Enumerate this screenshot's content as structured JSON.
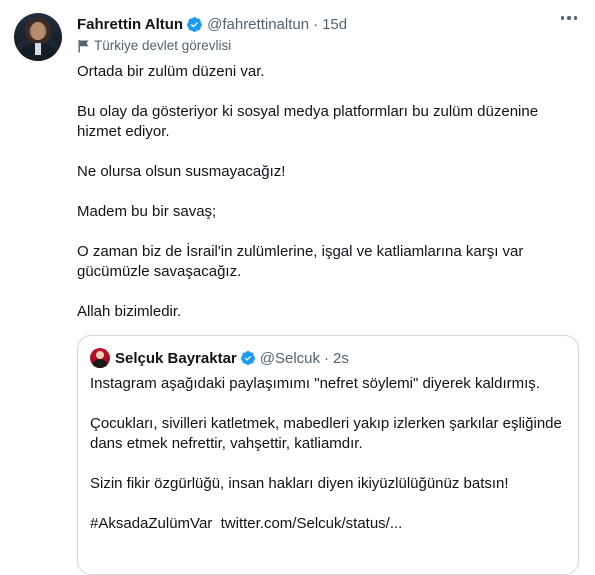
{
  "tweet": {
    "author_name": "Fahrettin Altun",
    "author_handle": "@fahrettinaltun",
    "separator": "·",
    "time": "15d",
    "label": "Türkiye devlet görevlisi",
    "paragraphs": [
      "Ortada bir zulüm düzeni var.",
      "Bu olay da gösteriyor ki sosyal medya platformları bu zulüm düzenine hizmet ediyor.",
      "Ne olursa olsun susmayacağız!",
      "Madem bu bir savaş;",
      "O zaman biz de İsrail'in zulümlerine, işgal ve katliamlarına karşı var gücümüzle savaşacağız.",
      "Allah bizimledir."
    ]
  },
  "quote": {
    "author_name": "Selçuk Bayraktar",
    "author_handle": "@Selcuk",
    "separator": "·",
    "time": "2s",
    "paragraphs": [
      "Instagram aşağıdaki paylaşımımı \"nefret söylemi\" diyerek kaldırmış.",
      "Çocukları, sivilleri katletmek, mabedleri yakıp izlerken şarkılar eşliğinde dans etmek nefrettir, vahşettir, katliamdır.",
      "Sizin fikir özgürlüğü, insan hakları diyen ikiyüzlülüğünüz batsın!"
    ],
    "hashtag": "#AksadaZulümVar",
    "link": "twitter.com/Selcuk/status/..."
  },
  "icons": {
    "verified": "verified-badge-icon",
    "label": "flag-icon",
    "more": "more-icon"
  },
  "colors": {
    "verified": "#1d9bf0",
    "text": "#0f1419",
    "secondary": "#536471",
    "border": "#cfd9de"
  }
}
